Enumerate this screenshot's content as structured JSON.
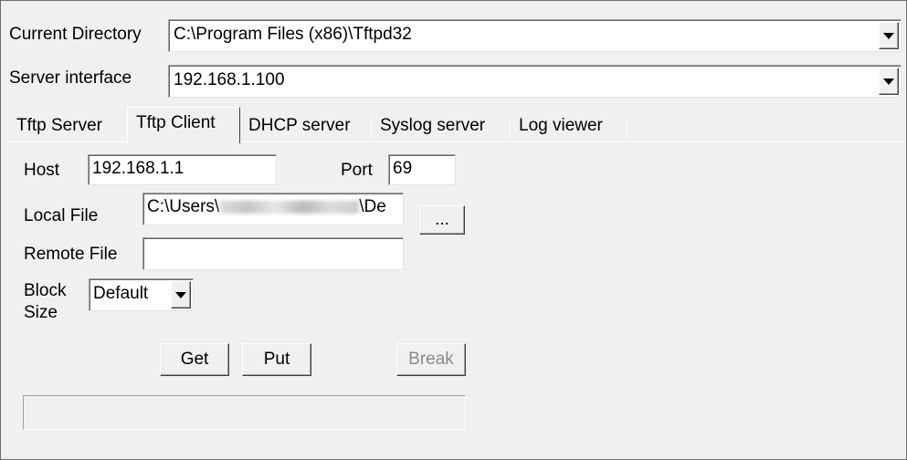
{
  "current_directory": {
    "label": "Current Directory",
    "value": "C:\\Program Files (x86)\\Tftpd32"
  },
  "server_interface": {
    "label": "Server interface",
    "value": "192.168.1.100"
  },
  "tabs": [
    {
      "label": "Tftp Server"
    },
    {
      "label": "Tftp Client"
    },
    {
      "label": "DHCP server"
    },
    {
      "label": "Syslog server"
    },
    {
      "label": "Log viewer"
    }
  ],
  "active_tab": "Tftp Client",
  "client": {
    "host_label": "Host",
    "host_value": "192.168.1.1",
    "port_label": "Port",
    "port_value": "69",
    "local_file_label": "Local File",
    "local_file_prefix": "C:\\Users\\",
    "local_file_suffix": "\\De",
    "browse_label": "...",
    "remote_file_label": "Remote File",
    "remote_file_value": "",
    "block_label_1": "Block",
    "block_label_2": "Size",
    "block_size_value": "Default",
    "get_label": "Get",
    "put_label": "Put",
    "break_label": "Break"
  },
  "icons": [
    "chevron-down-icon"
  ]
}
